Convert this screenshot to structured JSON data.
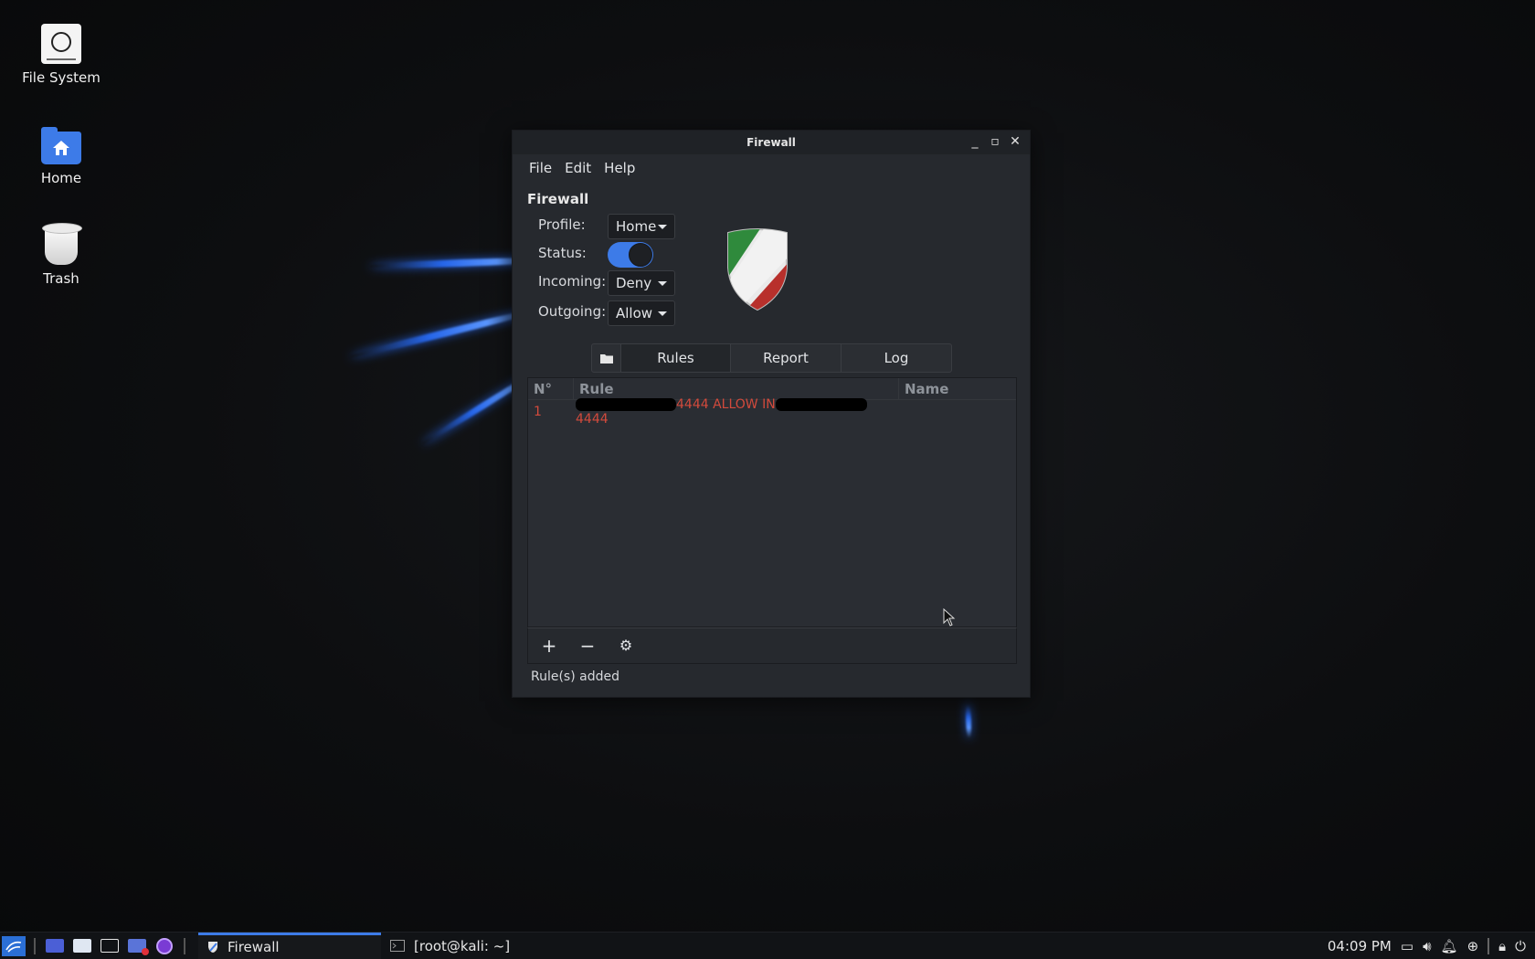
{
  "desktop": {
    "icons": [
      {
        "label": "File System"
      },
      {
        "label": "Home"
      },
      {
        "label": "Trash"
      }
    ]
  },
  "window": {
    "title": "Firewall",
    "menu": [
      "File",
      "Edit",
      "Help"
    ],
    "section_title": "Firewall",
    "form": {
      "profile_label": "Profile:",
      "profile_value": "Home",
      "status_label": "Status:",
      "status_on": true,
      "incoming_label": "Incoming:",
      "incoming_value": "Deny",
      "outgoing_label": "Outgoing:",
      "outgoing_value": "Allow"
    },
    "tabs": [
      "Rules",
      "Report",
      "Log"
    ],
    "active_tab": "Rules",
    "table": {
      "headers": [
        "N°",
        "Rule",
        "Name"
      ],
      "rows": [
        {
          "no": "1",
          "rule_mid": "4444 ALLOW IN",
          "rule_end": "4444",
          "name": ""
        }
      ]
    },
    "status_message": "Rule(s) added"
  },
  "taskbar": {
    "tasks": [
      {
        "label": "Firewall",
        "active": true
      },
      {
        "label": "[root@kali: ~]",
        "active": false
      }
    ],
    "clock": "04:09 PM"
  },
  "colors": {
    "accent": "#3d7be8",
    "rule_text": "#d24a3c",
    "window_bg": "#26292e"
  }
}
